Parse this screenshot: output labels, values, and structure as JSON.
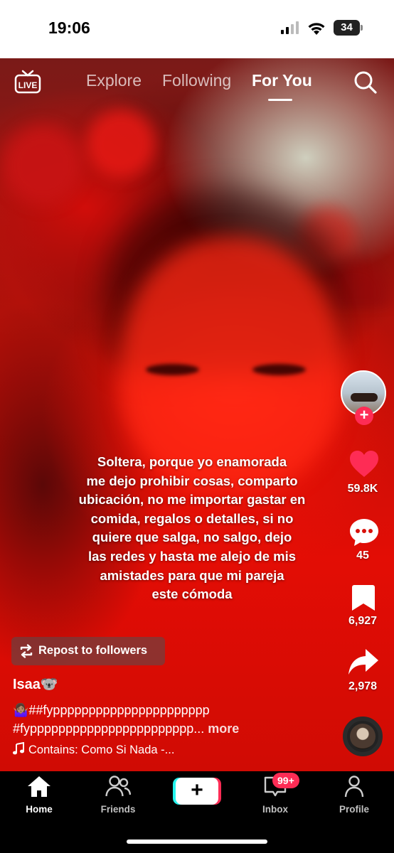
{
  "status_bar": {
    "time": "19:06",
    "battery": "34"
  },
  "top_nav": {
    "live_label": "LIVE",
    "tabs": [
      {
        "label": "Explore",
        "active": false
      },
      {
        "label": "Following",
        "active": false
      },
      {
        "label": "For You",
        "active": true
      }
    ]
  },
  "caption": {
    "lines": [
      "Soltera, porque yo enamorada",
      "me dejo prohibir cosas, comparto",
      "ubicación, no me importar gastar en",
      "comida, regalos o detalles, si no",
      "quiere que salga, no salgo, dejo",
      "las redes y hasta me alejo de mis",
      "amistades para que mi pareja",
      "este cómoda"
    ]
  },
  "rail": {
    "likes": "59.8K",
    "comments": "45",
    "saves": "6,927",
    "shares": "2,978"
  },
  "repost_label": "Repost to followers",
  "post": {
    "username": "Isaa🐨",
    "description_line1": "🤷🏽‍♀️##fypppppppppppppppppppppp",
    "description_line2": "#fyppppppppppppppppppppppp...",
    "more_label": "more",
    "music": "Contains: Como Si Nada -..."
  },
  "bottom_nav": {
    "items": [
      {
        "label": "Home",
        "active": true
      },
      {
        "label": "Friends",
        "active": false
      },
      {
        "label": "Inbox",
        "active": false
      },
      {
        "label": "Profile",
        "active": false
      }
    ],
    "inbox_badge": "99+"
  },
  "colors": {
    "accent": "#fe2c55",
    "cyan": "#25f4ee",
    "video_red": "#e30d05"
  }
}
